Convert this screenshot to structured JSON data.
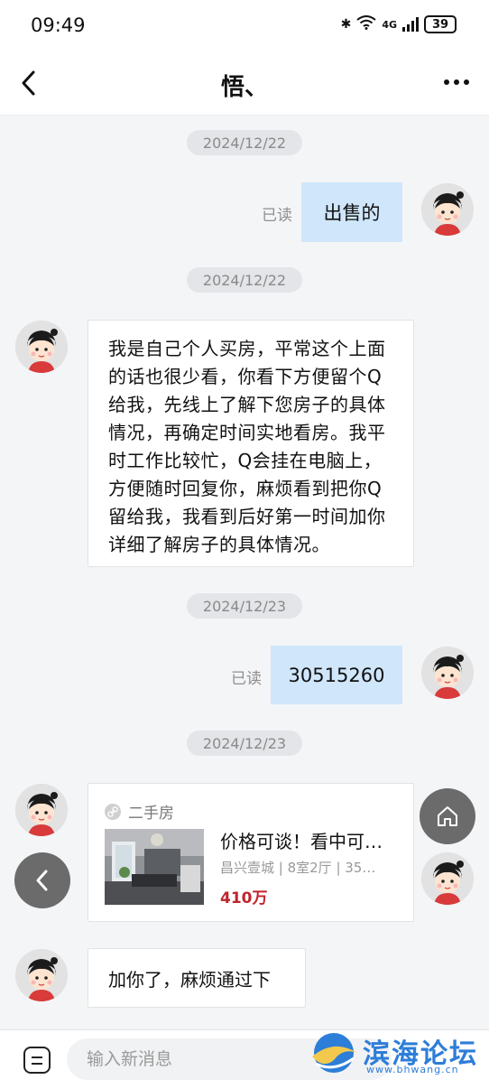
{
  "status_bar": {
    "time": "09:49",
    "network": "4G",
    "battery": "39"
  },
  "header": {
    "title": "悟、"
  },
  "messages": [
    {
      "type": "date",
      "text": "2024/12/22"
    },
    {
      "type": "me",
      "read": "已读",
      "text": "出售的"
    },
    {
      "type": "date",
      "text": "2024/12/22"
    },
    {
      "type": "other",
      "text": "我是自己个人买房，平常这个上面的话也很少看，你看下方便留个Q给我，先线上了解下您房子的具体情况，再确定时间实地看房。我平时工作比较忙，Q会挂在电脑上，方便随时回复你，麻烦看到把你Q留给我，我看到后好第一时间加你详细了解房子的具体情况。"
    },
    {
      "type": "date",
      "text": "2024/12/23"
    },
    {
      "type": "me",
      "read": "已读",
      "text": "30515260"
    },
    {
      "type": "date",
      "text": "2024/12/23"
    },
    {
      "type": "card",
      "tag": "二手房",
      "title": "价格可谈！看中可…",
      "subtitle": "昌兴壹城 | 8室2厅 | 35…",
      "price": "410万"
    },
    {
      "type": "other",
      "text": "加你了，麻烦通过下"
    }
  ],
  "input": {
    "placeholder": "输入新消息"
  },
  "watermark": {
    "text": "滨海论坛",
    "url": "www.bhwang.cn"
  },
  "colors": {
    "my_bubble": "#cfe6fb",
    "price": "#c0242c",
    "brand": "#2d7ed8"
  },
  "icons": [
    "back-icon",
    "more-icon",
    "home-icon",
    "chevron-left-icon",
    "emoji-icon",
    "link-icon",
    "avatar-icon"
  ]
}
